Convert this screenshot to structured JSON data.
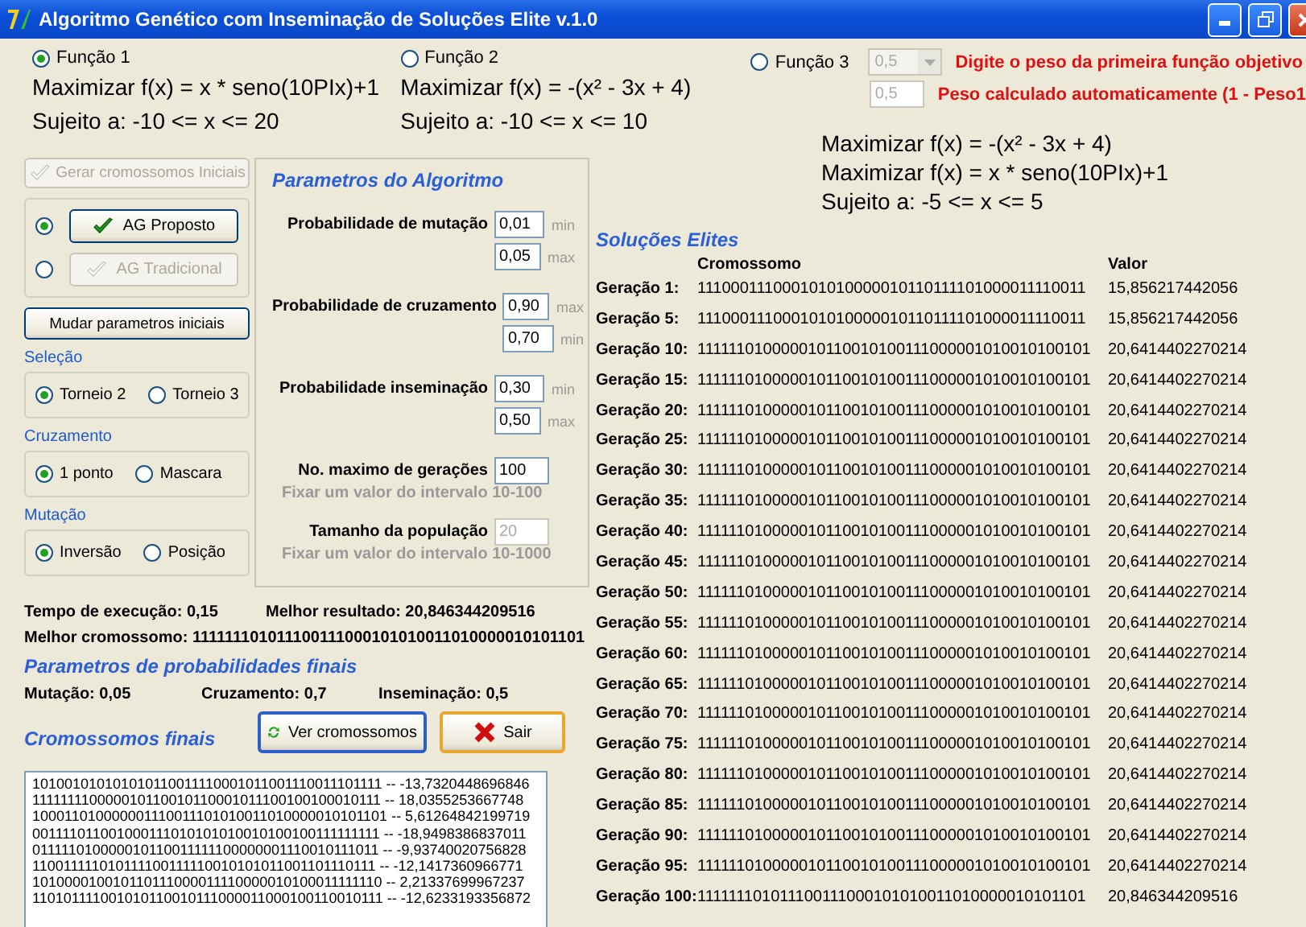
{
  "window": {
    "title": "Algoritmo Genético com Inseminação de Soluções Elite v.1.0"
  },
  "functions": [
    {
      "kind": "single",
      "label": "Função 1",
      "selected": true,
      "objectives": [
        "Maximizar f(x) = x * seno(10PIx)+1"
      ],
      "constraint": "Sujeito a: -10 <= x <= 20"
    },
    {
      "kind": "single",
      "label": "Função 2",
      "selected": false,
      "objectives": [
        "Maximizar f(x) = -(x²  - 3x + 4)"
      ],
      "constraint": "Sujeito a: -10 <= x <= 10"
    },
    {
      "kind": "multi",
      "label": "Função 3",
      "selected": false,
      "weight_1": "0,5",
      "weight_1_hint": "Digite o peso da primeira função objetivo",
      "weight_2": "0,5",
      "weight_2_hint": "Peso calculado automaticamente (1 - Peso1",
      "objectives": [
        "Maximizar f(x) = -(x²  - 3x + 4)",
        "Maximizar f(x) = x * seno(10PIx)+1"
      ],
      "constraint": "Sujeito a: -5 <= x <= 5"
    }
  ],
  "generate_button": {
    "label": "Gerar cromossomos Iniciais",
    "disabled": true
  },
  "algorithms": [
    {
      "label": "AG Proposto",
      "selected": true,
      "disabled": false
    },
    {
      "label": "AG Tradicional",
      "selected": false,
      "disabled": true
    }
  ],
  "change_params_button": "Mudar parametros iniciais",
  "option_groups": [
    {
      "title": "Seleção",
      "options": [
        {
          "label": "Torneio 2",
          "selected": true
        },
        {
          "label": "Torneio 3",
          "selected": false
        }
      ]
    },
    {
      "title": "Cruzamento",
      "options": [
        {
          "label": "1 ponto",
          "selected": true
        },
        {
          "label": "Mascara",
          "selected": false
        }
      ]
    },
    {
      "title": "Mutação",
      "options": [
        {
          "label": "Inversão",
          "selected": true
        },
        {
          "label": "Posição",
          "selected": false
        }
      ]
    }
  ],
  "parameters": {
    "title": "Parametros do Algoritmo",
    "rows": [
      {
        "label": "Probabilidade de mutação",
        "fields": [
          {
            "value": "0,01",
            "bound": "min",
            "disabled": false
          },
          {
            "value": "0,05",
            "bound": "max",
            "disabled": false
          }
        ]
      },
      {
        "label": "Probabilidade de cruzamento",
        "fields": [
          {
            "value": "0,90",
            "bound": "max",
            "disabled": false
          },
          {
            "value": "0,70",
            "bound": "min",
            "disabled": false
          }
        ]
      },
      {
        "label": "Probabilidade inseminação",
        "fields": [
          {
            "value": "0,30",
            "bound": "min",
            "disabled": false
          },
          {
            "value": "0,50",
            "bound": "max",
            "disabled": false
          }
        ]
      },
      {
        "label": "No. maximo de gerações",
        "fields": [
          {
            "value": "100",
            "disabled": false
          }
        ],
        "hint": "Fixar um valor do intervalo 10-100"
      },
      {
        "label": "Tamanho da população",
        "fields": [
          {
            "value": "20",
            "disabled": true
          }
        ],
        "hint": "Fixar um valor do intervalo 10-1000"
      }
    ]
  },
  "results": {
    "execution_time": "Tempo de execução: 0,15",
    "best_result": "Melhor resultado: 20,846344209516",
    "best_chromosome": "Melhor cromossomo: 111111101011100111000101010011010000010101101"
  },
  "final_parameters": {
    "title": "Parametros de probabilidades finais",
    "items": [
      "Mutação: 0,05",
      "Cruzamento: 0,7",
      "Inseminação: 0,5"
    ]
  },
  "final_chromosomes": {
    "title": "Cromossomos finais",
    "buttons": [
      {
        "kind": "refresh",
        "label": "Ver cromossomos"
      },
      {
        "kind": "exit",
        "label": "Sair"
      }
    ],
    "lines": [
      "101001010101010110011110001011001110011101111 -- -13,7320448696846",
      "111111110000010110010110001011100100100010111 -- 18,0355253667748",
      "100011010000001110011101010011010000010101101 -- 5,61264842199719",
      "001111011001000111010101010010100100111111111 -- -18,9498386837011",
      "011111010000010110011111100000001110010111011 -- -9,93740020756828",
      "110011111010111100111110010101011001101110111 -- -12,1417360966771",
      "101000010010110111000011110000010100011111110 -- 2,21337699967237",
      "110101111001010110010111000011000100110010111 -- -12,6233193356872"
    ]
  },
  "elites": {
    "title": "Soluções Elites",
    "columns": [
      "Cromossomo",
      "Valor"
    ],
    "rows": [
      {
        "generation": "Geração 1:",
        "chromosome": "111000111000101010000010110111101000011110011",
        "value": "15,856217442056"
      },
      {
        "generation": "Geração 5:",
        "chromosome": "111000111000101010000010110111101000011110011",
        "value": "15,856217442056"
      },
      {
        "generation": "Geração 10:",
        "chromosome": "111111010000010110010100111000001010010100101",
        "value": "20,6414402270214"
      },
      {
        "generation": "Geração 15:",
        "chromosome": "111111010000010110010100111000001010010100101",
        "value": "20,6414402270214"
      },
      {
        "generation": "Geração 20:",
        "chromosome": "111111010000010110010100111000001010010100101",
        "value": "20,6414402270214"
      },
      {
        "generation": "Geração 25:",
        "chromosome": "111111010000010110010100111000001010010100101",
        "value": "20,6414402270214"
      },
      {
        "generation": "Geração 30:",
        "chromosome": "111111010000010110010100111000001010010100101",
        "value": "20,6414402270214"
      },
      {
        "generation": "Geração 35:",
        "chromosome": "111111010000010110010100111000001010010100101",
        "value": "20,6414402270214"
      },
      {
        "generation": "Geração 40:",
        "chromosome": "111111010000010110010100111000001010010100101",
        "value": "20,6414402270214"
      },
      {
        "generation": "Geração 45:",
        "chromosome": "111111010000010110010100111000001010010100101",
        "value": "20,6414402270214"
      },
      {
        "generation": "Geração 50:",
        "chromosome": "111111010000010110010100111000001010010100101",
        "value": "20,6414402270214"
      },
      {
        "generation": "Geração 55:",
        "chromosome": "111111010000010110010100111000001010010100101",
        "value": "20,6414402270214"
      },
      {
        "generation": "Geração 60:",
        "chromosome": "111111010000010110010100111000001010010100101",
        "value": "20,6414402270214"
      },
      {
        "generation": "Geração 65:",
        "chromosome": "111111010000010110010100111000001010010100101",
        "value": "20,6414402270214"
      },
      {
        "generation": "Geração 70:",
        "chromosome": "111111010000010110010100111000001010010100101",
        "value": "20,6414402270214"
      },
      {
        "generation": "Geração 75:",
        "chromosome": "111111010000010110010100111000001010010100101",
        "value": "20,6414402270214"
      },
      {
        "generation": "Geração 80:",
        "chromosome": "111111010000010110010100111000001010010100101",
        "value": "20,6414402270214"
      },
      {
        "generation": "Geração 85:",
        "chromosome": "111111010000010110010100111000001010010100101",
        "value": "20,6414402270214"
      },
      {
        "generation": "Geração 90:",
        "chromosome": "111111010000010110010100111000001010010100101",
        "value": "20,6414402270214"
      },
      {
        "generation": "Geração 95:",
        "chromosome": "111111010000010110010100111000001010010100101",
        "value": "20,6414402270214"
      },
      {
        "generation": "Geração 100:",
        "chromosome": "111111101011100111000101010011010000010101101",
        "value": "20,846344209516"
      }
    ]
  }
}
